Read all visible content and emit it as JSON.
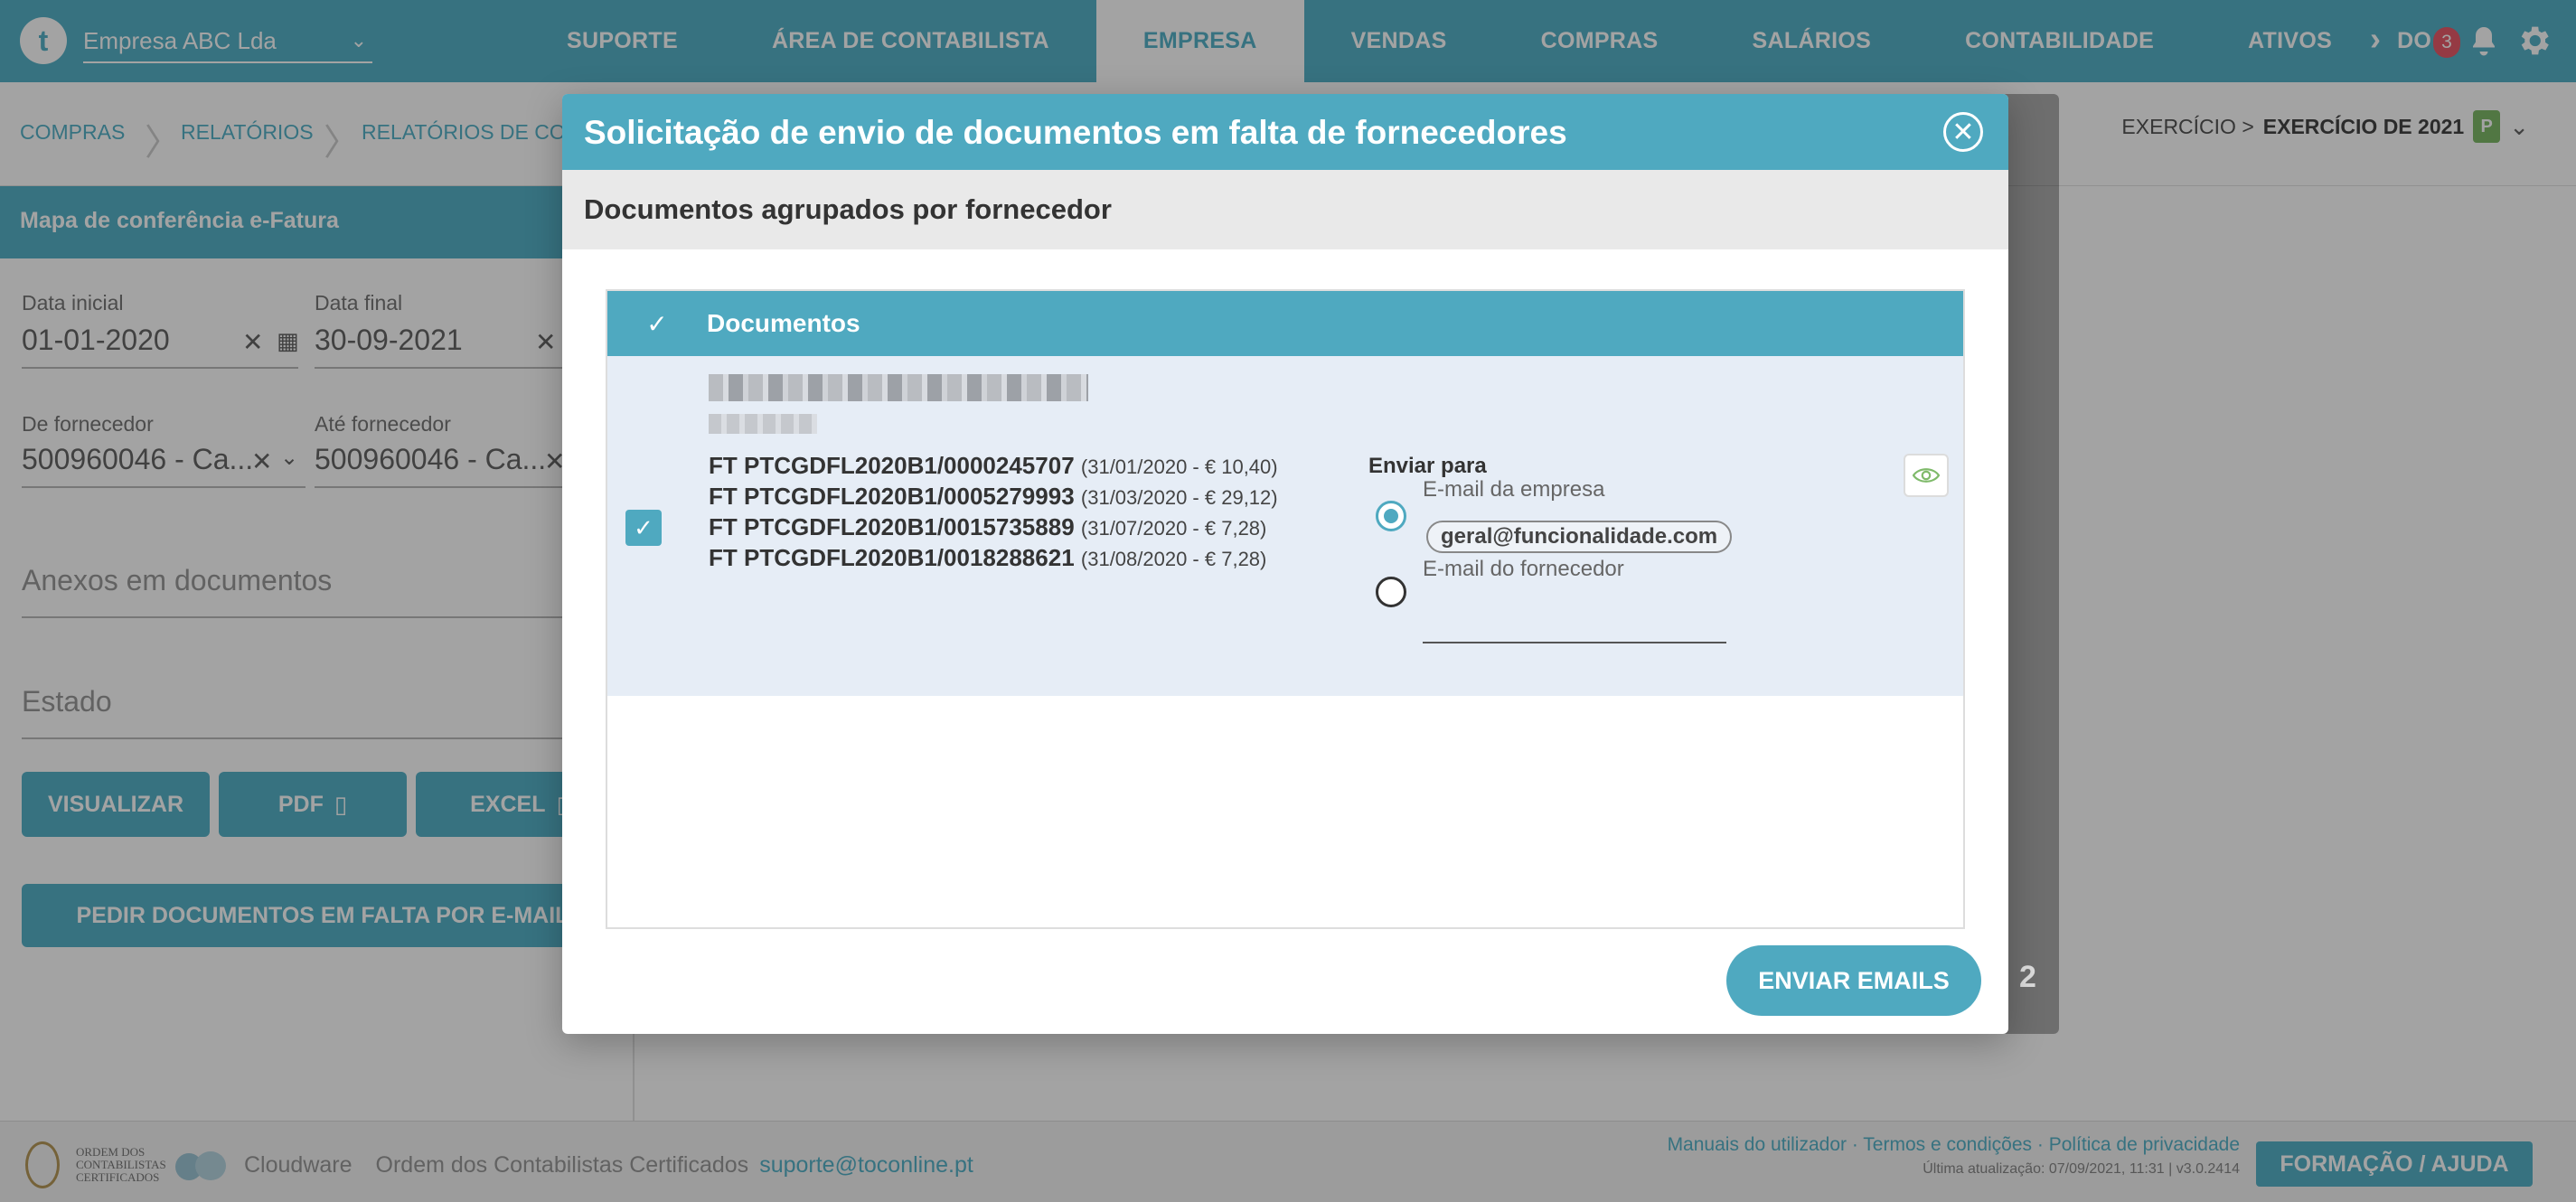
{
  "topbar": {
    "logo_letter": "t",
    "company": "Empresa ABC Lda",
    "nav": [
      "SUPORTE",
      "ÁREA DE CONTABILISTA",
      "EMPRESA",
      "VENDAS",
      "COMPRAS",
      "SALÁRIOS",
      "CONTABILIDADE",
      "ATIVOS",
      "DO"
    ],
    "active_nav": "EMPRESA",
    "notification_count": "3"
  },
  "breadcrumb": {
    "items": [
      "COMPRAS",
      "RELATÓRIOS",
      "RELATÓRIOS DE COMPR"
    ],
    "exercise_prefix": "EXERCÍCIO >",
    "exercise_value": "EXERCÍCIO DE 2021",
    "exercise_badge": "P"
  },
  "left_panel": {
    "title": "Mapa de conferência e-Fatura",
    "start_date_label": "Data inicial",
    "start_date": "01-01-2020",
    "end_date_label": "Data final",
    "end_date": "30-09-2021",
    "from_supplier_label": "De fornecedor",
    "from_supplier": "500960046 - Ca...",
    "to_supplier_label": "Até fornecedor",
    "to_supplier": "500960046 - Ca...",
    "attachments_placeholder": "Anexos em documentos",
    "status_placeholder": "Estado",
    "btn_view": "VISUALIZAR",
    "btn_pdf": "PDF",
    "btn_excel": "EXCEL",
    "btn_request": "PEDIR DOCUMENTOS EM FALTA POR E-MAIL"
  },
  "background_number": "2",
  "modal": {
    "title": "Solicitação de envio de documentos em falta de fornecedores",
    "subtitle": "Documentos agrupados por fornecedor",
    "table_header": "Documentos",
    "documents": [
      {
        "number": "FT PTCGDFL2020B1/0000245707",
        "meta": "(31/01/2020 - € 10,40)"
      },
      {
        "number": "FT PTCGDFL2020B1/0005279993",
        "meta": "(31/03/2020 - € 29,12)"
      },
      {
        "number": "FT PTCGDFL2020B1/0015735889",
        "meta": "(31/07/2020 - € 7,28)"
      },
      {
        "number": "FT PTCGDFL2020B1/0018288621",
        "meta": "(31/08/2020 - € 7,28)"
      }
    ],
    "send_to_label": "Enviar para",
    "option_company_label": "E-mail da empresa",
    "company_email": "geral@funcionalidade.com",
    "option_supplier_label": "E-mail do fornecedor",
    "send_button": "ENVIAR EMAILS"
  },
  "footer": {
    "occ_text": "ORDEM DOS CONTABILISTAS CERTIFICADOS",
    "cloudware": "Cloudware",
    "org": "Ordem dos Contabilistas Certificados",
    "support_email": "suporte@toconline.pt",
    "links": "Manuais do utilizador · Termos e condições · Política de privacidade",
    "last_update": "Última atualização: 07/09/2021, 11:31 | v3.0.2414",
    "help_button": "FORMAÇÃO / AJUDA"
  },
  "colors": {
    "accent": "#56b3c9",
    "modal_accent": "#4fa9c0",
    "row_bg": "#e6edf6",
    "badge_red": "#e95b6b",
    "badge_green": "#7fba6a"
  }
}
